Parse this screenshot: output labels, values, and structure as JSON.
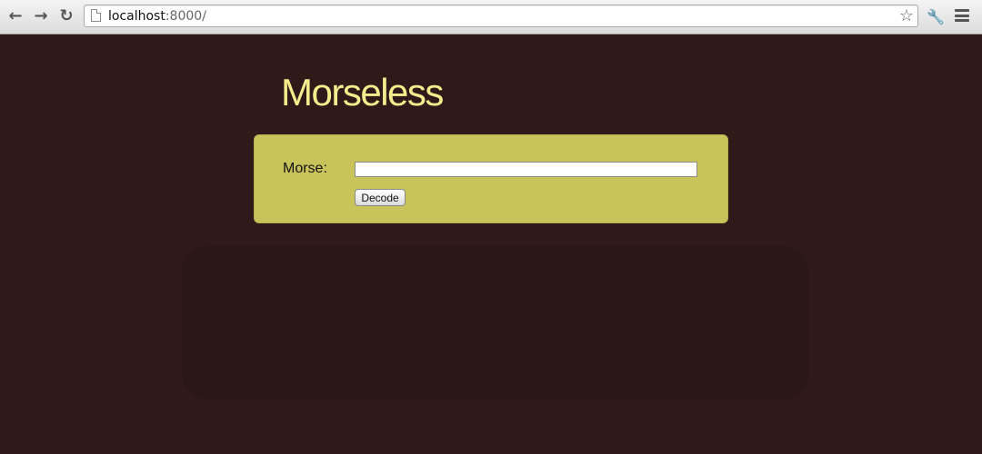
{
  "browser": {
    "url_host": "localhost",
    "url_rest": ":8000/",
    "icons": {
      "back": "back-arrow-icon",
      "forward": "forward-arrow-icon",
      "reload": "reload-icon",
      "page": "page-icon",
      "bookmark": "star-icon",
      "settings": "wrench-icon",
      "menu": "menu-icon"
    }
  },
  "page": {
    "title": "Morseless",
    "form": {
      "morse_label": "Morse:",
      "morse_value": "",
      "decode_label": "Decode"
    }
  },
  "colors": {
    "background": "#2f1919",
    "title": "#f6ec8d",
    "panel": "#c9c35c"
  }
}
